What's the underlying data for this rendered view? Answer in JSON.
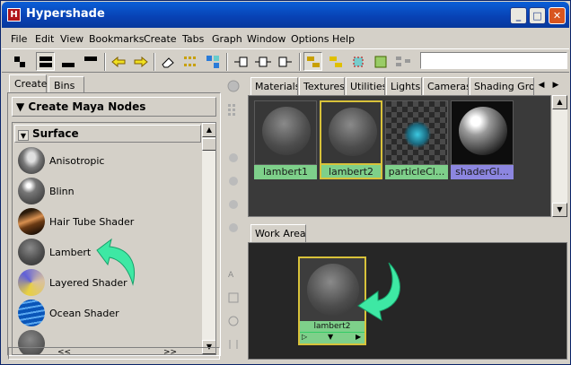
{
  "window": {
    "title": "Hypershade",
    "app_icon": "H"
  },
  "menus": [
    "File",
    "Edit",
    "View",
    "Bookmarks",
    "Create",
    "Tabs",
    "Graph",
    "Window",
    "Options",
    "Help"
  ],
  "left": {
    "tabs": [
      "Create",
      "Bins"
    ],
    "header": "Create Maya Nodes",
    "category": "Surface",
    "nodes": [
      "Anisotropic",
      "Blinn",
      "Hair Tube Shader",
      "Lambert",
      "Layered Shader",
      "Ocean Shader"
    ],
    "scroll_left": "<<",
    "scroll_right": ">>"
  },
  "right": {
    "tabs": [
      "Materials",
      "Textures",
      "Utilities",
      "Lights",
      "Cameras",
      "Shading Grou"
    ],
    "swatches": [
      {
        "label": "lambert1",
        "color": "#7ed08a"
      },
      {
        "label": "lambert2",
        "color": "#7ed08a"
      },
      {
        "label": "particleCl...",
        "color": "#7ed08a"
      },
      {
        "label": "shaderGl...",
        "color": "#8c86e0"
      }
    ],
    "work_tab": "Work Area",
    "work_node": "lambert2"
  },
  "colors": {
    "accent_arrow": "#3ee8a4",
    "selected_border": "#d8c23a",
    "title_bar": "#0841b3"
  }
}
